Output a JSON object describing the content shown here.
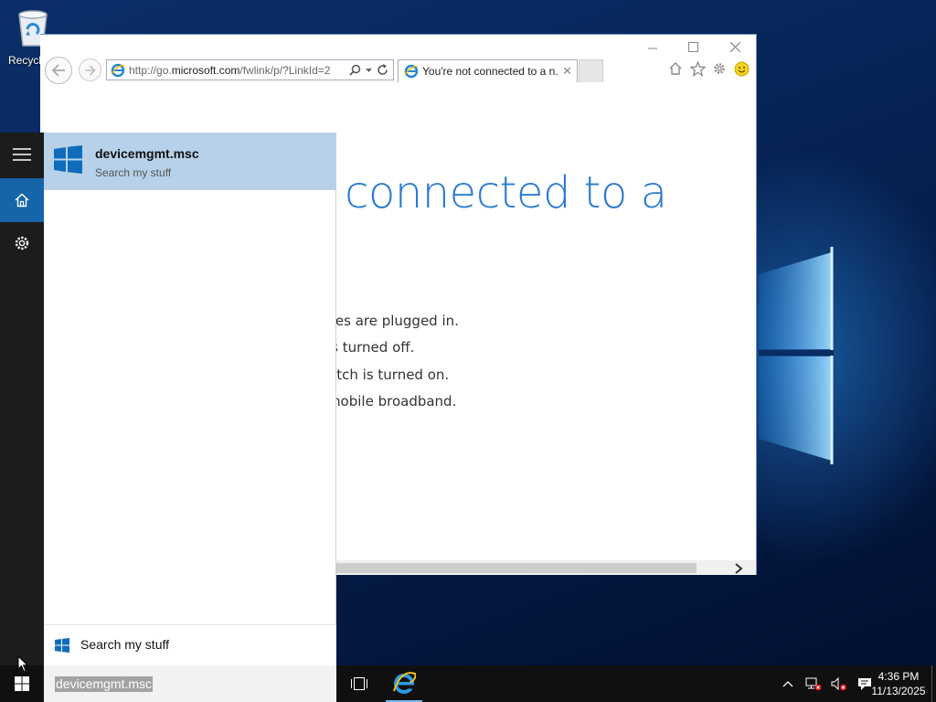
{
  "desktop": {
    "recycle_bin_label": "Recycl"
  },
  "browser": {
    "address_url_prefix": "http://go.",
    "address_url_domain": "microsoft.com",
    "address_url_path": "/fwlink/p/?LinkId=2",
    "tab_title": "You're not connected to a n...",
    "tab_close": "✕",
    "page": {
      "heading": "t connected to a",
      "lines": [
        "ables are plugged in.",
        "e is turned off.",
        "switch is turned on.",
        "o mobile broadband."
      ]
    }
  },
  "search_panel": {
    "best_result_title": "devicemgmt.msc",
    "best_result_subtitle": "Search my stuff",
    "search_my_stuff_label": "Search my stuff"
  },
  "taskbar": {
    "search_query": "devicemgmt.msc",
    "clock_time": "4:36 PM",
    "clock_date": "11/13/2025"
  },
  "colors": {
    "accent": "#1565a8",
    "result_highlight": "#b7d1ea",
    "heading_blue": "#2b7bd3"
  },
  "icons": {
    "window_controls": [
      "minimize-icon",
      "maximize-icon",
      "close-icon"
    ],
    "browser_tools": [
      "home-icon",
      "favorites-star-icon",
      "settings-gear-icon",
      "feedback-smiley-icon"
    ],
    "tray": [
      "chevron-up-icon",
      "network-icon",
      "volume-muted-icon",
      "action-center-icon"
    ]
  }
}
